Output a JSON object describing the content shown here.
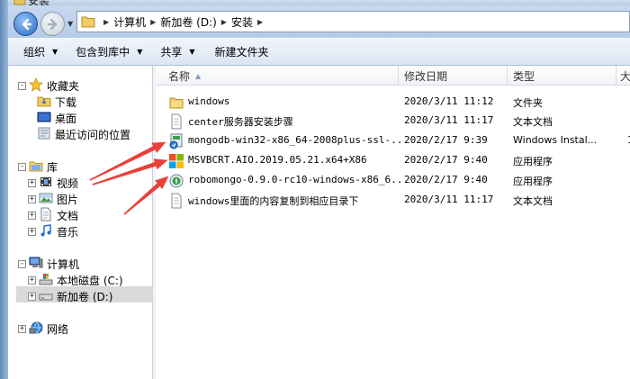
{
  "window": {
    "title": "安装"
  },
  "address": {
    "crumbs": [
      "计算机",
      "新加卷 (D:)",
      "安装"
    ]
  },
  "toolbar": {
    "organize": "组织",
    "include_library": "包含到库中",
    "share": "共享",
    "new_folder": "新建文件夹"
  },
  "nav": {
    "favorites": "收藏夹",
    "downloads": "下载",
    "desktop": "桌面",
    "recent": "最近访问的位置",
    "libraries": "库",
    "videos": "视频",
    "pictures": "图片",
    "documents": "文档",
    "music": "音乐",
    "computer": "计算机",
    "local_disk": "本地磁盘 (C:)",
    "new_volume": "新加卷 (D:)",
    "network": "网络"
  },
  "columns": {
    "name": "名称",
    "date": "修改日期",
    "type": "类型",
    "size": "大"
  },
  "files": [
    {
      "name": "windows",
      "date": "2020/3/11 11:12",
      "type": "文件夹",
      "size": "",
      "icon": "folder-icon"
    },
    {
      "name": "center服务器安装步骤",
      "date": "2020/3/11 11:17",
      "type": "文本文档",
      "size": "",
      "icon": "text-file-icon"
    },
    {
      "name": "mongodb-win32-x86_64-2008plus-ssl-...",
      "date": "2020/2/17 9:39",
      "type": "Windows Instal...",
      "size": "1",
      "icon": "msi-installer-icon"
    },
    {
      "name": "MSVBCRT.AIO.2019.05.21.x64+X86",
      "date": "2020/2/17 9:40",
      "type": "应用程序",
      "size": "",
      "icon": "windows-app-icon"
    },
    {
      "name": "robomongo-0.9.0-rc10-windows-x86_6...",
      "date": "2020/2/17 9:40",
      "type": "应用程序",
      "size": "",
      "icon": "robomongo-app-icon"
    },
    {
      "name": "windows里面的内容复制到相应目录下",
      "date": "2020/3/11 11:17",
      "type": "文本文档",
      "size": "",
      "icon": "text-file-icon"
    }
  ],
  "annotation": {
    "arrow_color": "#e8413a"
  }
}
